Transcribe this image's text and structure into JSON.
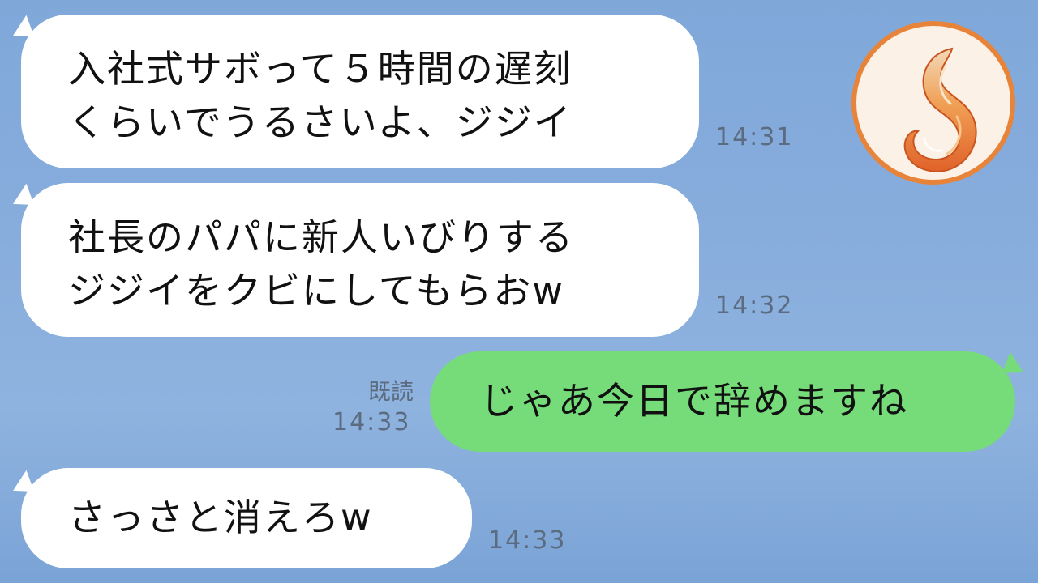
{
  "messages": [
    {
      "direction": "incoming",
      "lines": [
        "入社式サボって５時間の遅刻",
        "くらいでうるさいよ、ジジイ"
      ],
      "time": "14:31"
    },
    {
      "direction": "incoming",
      "lines": [
        "社長のパパに新人いびりする",
        "ジジイをクビにしてもらおw"
      ],
      "time": "14:32"
    },
    {
      "direction": "outgoing",
      "lines": [
        "じゃあ今日で辞めますね"
      ],
      "read_label": "既読",
      "time": "14:33"
    },
    {
      "direction": "incoming",
      "lines": [
        "さっさと消えろw"
      ],
      "time": "14:33"
    }
  ],
  "avatar": {
    "icon": "fox-tail-icon",
    "ring_color": "#e8843a"
  },
  "colors": {
    "background": "#86acdc",
    "incoming_bubble": "#ffffff",
    "outgoing_bubble": "#76dc7a",
    "meta_text": "#5c6c80"
  }
}
